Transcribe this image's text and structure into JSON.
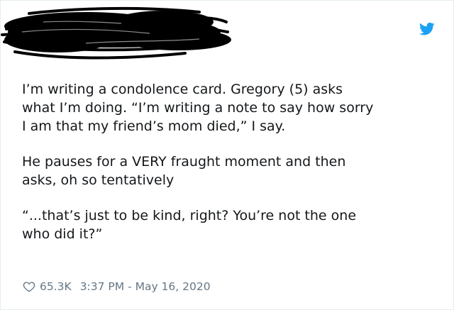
{
  "tweet": {
    "paragraphs": [
      "I’m writing a condolence card. Gregory (5) asks\nwhat I’m doing. “I’m writing a note to say how sorry\nI am that my friend’s mom died,” I say.",
      "He pauses for a VERY fraught moment and then\nasks, oh so tentatively",
      "“...that’s just to be kind, right? You’re not the one\nwho did it?”"
    ],
    "likes": "65.3K",
    "timestamp": "3:37 PM - May 16, 2020"
  },
  "icons": {
    "brand": "twitter-bird-icon",
    "like": "heart-icon"
  },
  "colors": {
    "brand_blue": "#1da1f2",
    "text_primary": "#14171a",
    "text_secondary": "#657786",
    "redaction": "#000000"
  }
}
